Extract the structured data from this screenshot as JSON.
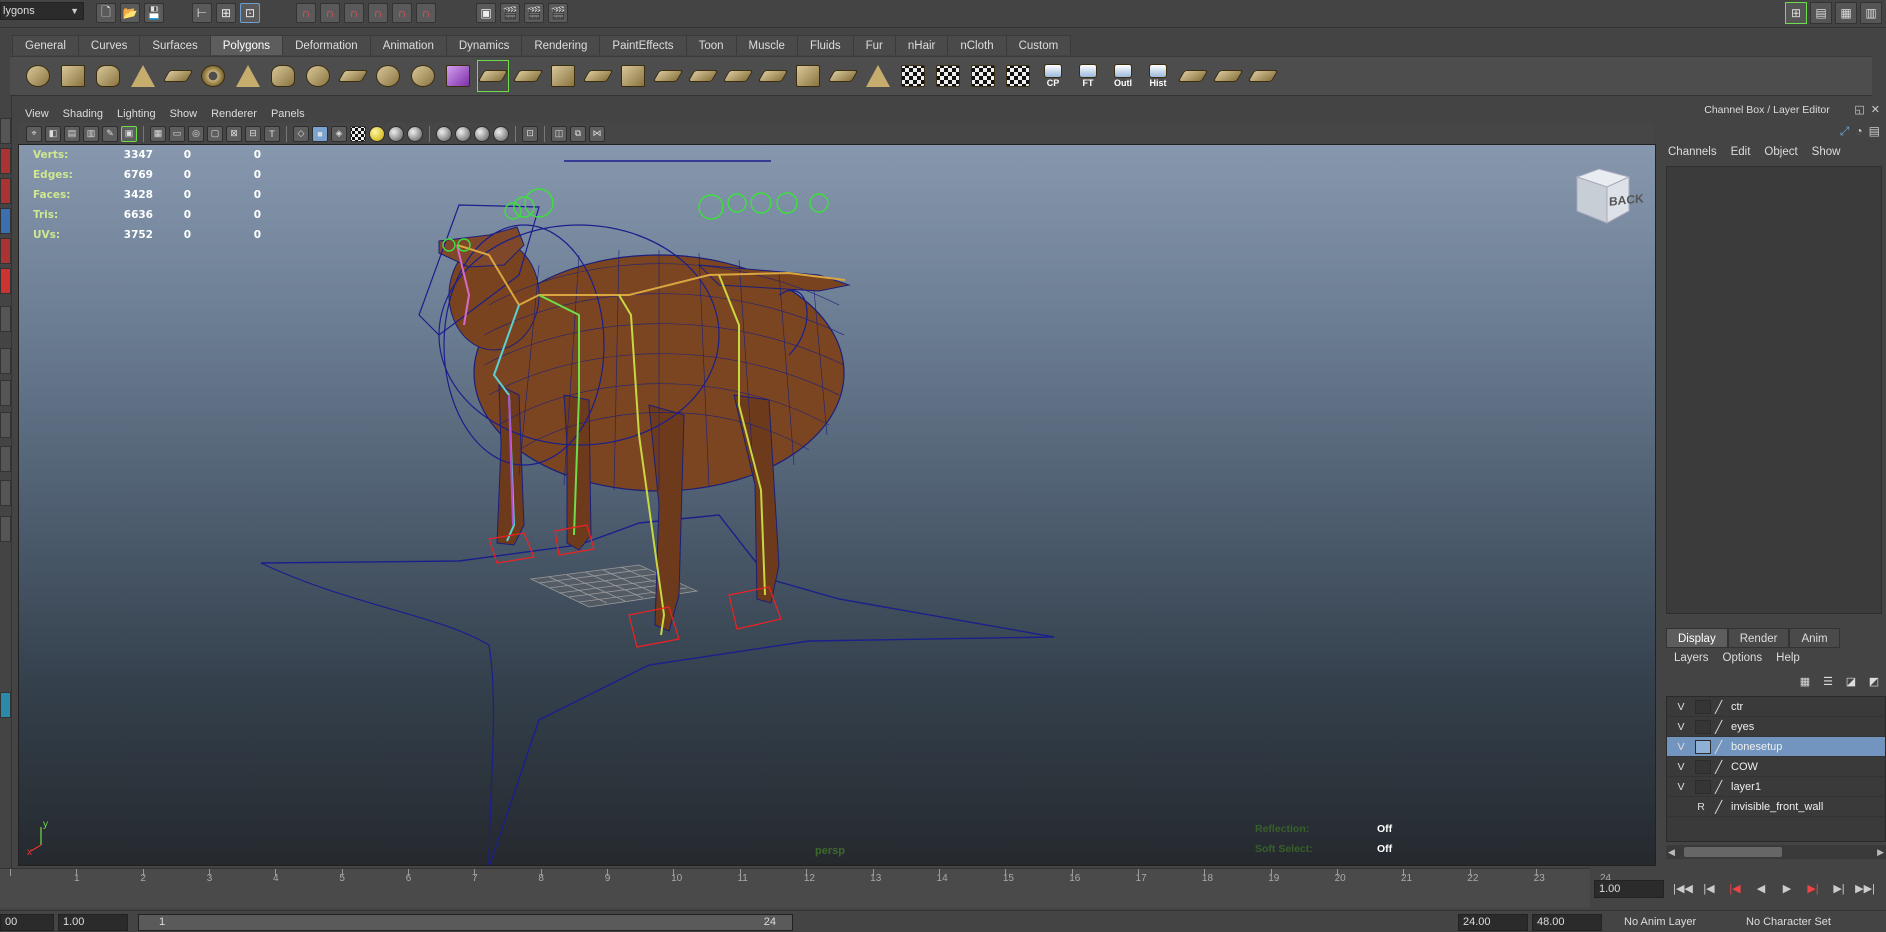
{
  "status_line": {
    "mode": "lygons"
  },
  "shelf_tabs": [
    "General",
    "Curves",
    "Surfaces",
    "Polygons",
    "Deformation",
    "Animation",
    "Dynamics",
    "Rendering",
    "PaintEffects",
    "Toon",
    "Muscle",
    "Fluids",
    "Fur",
    "nHair",
    "nCloth",
    "Custom"
  ],
  "shelf_active": "Polygons",
  "shelf_labels": {
    "cp": "CP",
    "ft": "FT",
    "outl": "Outl",
    "hist": "Hist"
  },
  "viewport": {
    "menu": [
      "View",
      "Shading",
      "Lighting",
      "Show",
      "Renderer",
      "Panels"
    ],
    "hud": [
      {
        "label": "Verts:",
        "v1": "3347",
        "v2": "0",
        "v3": "0"
      },
      {
        "label": "Edges:",
        "v1": "6769",
        "v2": "0",
        "v3": "0"
      },
      {
        "label": "Faces:",
        "v1": "3428",
        "v2": "0",
        "v3": "0"
      },
      {
        "label": "Tris:",
        "v1": "6636",
        "v2": "0",
        "v3": "0"
      },
      {
        "label": "UVs:",
        "v1": "3752",
        "v2": "0",
        "v3": "0"
      }
    ],
    "camera_name": "persp",
    "viewcube_label": "BACK",
    "reflection_label": "Reflection:",
    "reflection_value": "Off",
    "soft_select_label": "Soft Select:",
    "soft_select_value": "Off",
    "axis_x": "x",
    "axis_y": "y"
  },
  "channel_box": {
    "title": "Channel Box / Layer Editor",
    "menu": [
      "Channels",
      "Edit",
      "Object",
      "Show"
    ]
  },
  "layer_editor": {
    "tabs": [
      "Display",
      "Render",
      "Anim"
    ],
    "active_tab": "Display",
    "menu": [
      "Layers",
      "Options",
      "Help"
    ],
    "layers": [
      {
        "flag": "V",
        "name": "ctr",
        "selected": false
      },
      {
        "flag": "V",
        "name": "eyes",
        "selected": false
      },
      {
        "flag": "V",
        "name": "bonesetup",
        "selected": true
      },
      {
        "flag": "V",
        "name": "COW",
        "selected": false
      },
      {
        "flag": "V",
        "name": "layer1",
        "selected": false
      },
      {
        "flag": "R",
        "name": "invisible_front_wall",
        "selected": false
      }
    ]
  },
  "timeline": {
    "ticks": [
      "1",
      "2",
      "3",
      "4",
      "5",
      "6",
      "7",
      "8",
      "9",
      "10",
      "11",
      "12",
      "13",
      "14",
      "15",
      "16",
      "17",
      "18",
      "19",
      "20",
      "21",
      "22",
      "23",
      "24"
    ],
    "current_frame": "1.00"
  },
  "range_bar": {
    "start_time": "00",
    "playback_start": "1.00",
    "range_lo": "1",
    "range_hi": "24",
    "playback_end": "24.00",
    "end_time": "48.00",
    "anim_layer": "No Anim Layer",
    "character_set": "No Character Set"
  },
  "colors": {
    "viewport_top": "#8798ae",
    "viewport_bottom": "#25292e",
    "selected_layer": "#7295bf",
    "hud_label": "#cfe78f"
  }
}
